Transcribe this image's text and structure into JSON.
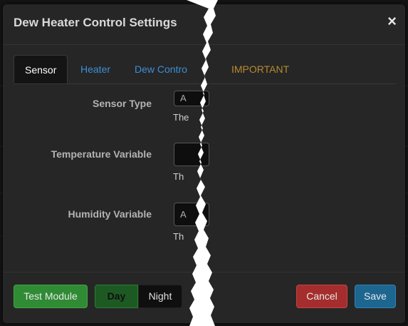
{
  "modal": {
    "title": "Dew Heater Control Settings",
    "close_label": "×"
  },
  "tabs": [
    {
      "label": "Sensor",
      "active": true
    },
    {
      "label": "Heater",
      "active": false
    },
    {
      "label": "Dew Contro",
      "active": false
    },
    {
      "label": "IMPORTANT",
      "active": false
    }
  ],
  "form": {
    "sensor_type": {
      "label": "Sensor Type",
      "value": "A",
      "help": "The"
    },
    "temperature_variable": {
      "label": "Temperature Variable",
      "value": "",
      "help": "Th"
    },
    "humidity_variable": {
      "label": "Humidity Variable",
      "value": "A",
      "help": "Th"
    }
  },
  "footer": {
    "test_module_label": "Test Module",
    "day_label": "Day",
    "night_label": "Night",
    "cancel_label": "Cancel",
    "save_label": "Save"
  },
  "colors": {
    "accent_link": "#3d8fd4",
    "important_tab": "#b88a2e",
    "success": "#2f8b34",
    "danger": "#a52d2d",
    "primary": "#1d6690"
  }
}
